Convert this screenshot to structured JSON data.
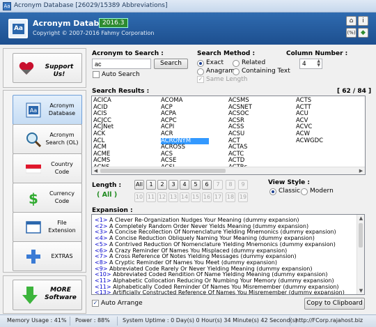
{
  "window": {
    "title": "Acronym Database [26029/15389 Abbreviations]"
  },
  "header": {
    "app_name": "Acronym Database",
    "version": "2016.3",
    "copyright": "Copyright © 2007-2016 Fahmy Corporation",
    "buttons": [
      "home-icon",
      "info-icon",
      "percent-icon",
      "shield-icon"
    ]
  },
  "support": {
    "label": "Support Us!"
  },
  "nav": [
    {
      "label": "Acronym Database",
      "icon": "aa-icon",
      "active": true
    },
    {
      "label": "Acronym Search (OL)",
      "icon": "magnifier-icon",
      "active": false
    },
    {
      "label": "Country Code",
      "icon": "flag-icon",
      "active": false
    },
    {
      "label": "Currency Code",
      "icon": "dollar-icon",
      "active": false
    },
    {
      "label": "File Extension",
      "icon": "window-icon",
      "active": false
    },
    {
      "label": "EXTRAS",
      "icon": "plus-icon",
      "active": false
    }
  ],
  "more_software": {
    "label": "MORE Software"
  },
  "search": {
    "label": "Acronym to Search :",
    "value": "ac",
    "button": "Search",
    "auto_search": "Auto Search"
  },
  "method": {
    "label": "Search Method :",
    "options": [
      "Exact",
      "Related",
      "Anagram",
      "Containing Text",
      "Same Length"
    ],
    "selected": "Exact"
  },
  "column_number": {
    "label": "Column Number :",
    "value": "4"
  },
  "results": {
    "label": "Search Results :",
    "count": "[ 62 / 84 ]",
    "columns": [
      [
        "ACICA",
        "ACID",
        "ACIS",
        "ACJCC",
        "ACJNet",
        "ACK",
        "ACL",
        "ACM",
        "ACME",
        "ACMS",
        "ACNS"
      ],
      [
        "ACOMA",
        "ACP",
        "ACPA",
        "ACPC",
        "ACPI",
        "ACR",
        "ACRONYM",
        "ACROSS",
        "ACS",
        "ACSE",
        "ACSL"
      ],
      [
        "ACSMS",
        "ACSNET",
        "ACSOC",
        "ACSR",
        "ACSS",
        "ACSU",
        "ACT",
        "ACTAS",
        "ACTC",
        "ACTD",
        "ACTRs"
      ],
      [
        "ACTS",
        "ACTT",
        "ACU",
        "ACV",
        "ACVC",
        "ACW",
        "ACWGDC"
      ]
    ],
    "selected": "ACRONYM"
  },
  "length": {
    "label": "Length :",
    "current": "( All )",
    "buttons_row1": [
      "All",
      "1",
      "2",
      "3",
      "4",
      "5",
      "6",
      "7",
      "8",
      "9"
    ],
    "buttons_row2": [
      "10",
      "11",
      "12",
      "13",
      "14",
      "15",
      "16",
      "17",
      "18",
      "19"
    ]
  },
  "view_style": {
    "label": "View Style :",
    "options": [
      "Classic",
      "Modern"
    ],
    "selected": "Classic"
  },
  "expansion": {
    "label": "Expansion :",
    "rows": [
      {
        "n": "<1>",
        "text": "A Clever Re-Organization Nudges Your Meaning (dummy expansion)"
      },
      {
        "n": "<2>",
        "text": "A Completely Random Order Never Yields Meaning (dummy expansion)"
      },
      {
        "n": "<3>",
        "text": "A Concise Recollection Of Nomenclature Yielding Mnemonics (dummy expansion)"
      },
      {
        "n": "<4>",
        "text": "A Concise Reduction Obliquely Naming Your Meaning (dummy expansion)"
      },
      {
        "n": "<5>",
        "text": "A Contrived Reduction Of Nomenclature Yielding Mnemonics (dummy expansion)"
      },
      {
        "n": "<6>",
        "text": "A Crazy Reminder Of Names You Misplaced (dummy expansion)"
      },
      {
        "n": "<7>",
        "text": "A Cross Reference Of Notes Yielding Messages (dummy expansion)"
      },
      {
        "n": "<8>",
        "text": "A Cryptic Reminder Of Names You Meet (dummy expansion)"
      },
      {
        "n": "<9>",
        "text": "Abbreviated Code Rarely Or Never Yielding Meaning (dummy expansion)"
      },
      {
        "n": "<10>",
        "text": "Abbreviated Coded Rendition Of Name Yielding Meaning (dummy expansion)"
      },
      {
        "n": "<11>",
        "text": "Alphabetic Collocation Reducing Or Numbing Your Memory (dummy expansion)"
      },
      {
        "n": "<11>",
        "text": "Alphabetically Coded Reminder Of Names You Misremember (dummy expansion)"
      },
      {
        "n": "<13>",
        "text": "Artificially Constructed Reference Of Names You Misremember (dummy expansion)"
      }
    ],
    "auto_arrange": "Auto Arrange",
    "copy_button": "Copy to Clipboard"
  },
  "status": {
    "memory": "Memory Usage : 41%",
    "power": "Power : 88%",
    "uptime": "System Uptime : 0 Day(s) 0 Hour(s) 34 Minute(s) 42 Second(s)",
    "url": "http://FCorp.rajahost.biz"
  },
  "colors": {
    "header_blue": "#1d4f8f",
    "selection": "#3399ff",
    "length_green": "#1f8a1f"
  }
}
